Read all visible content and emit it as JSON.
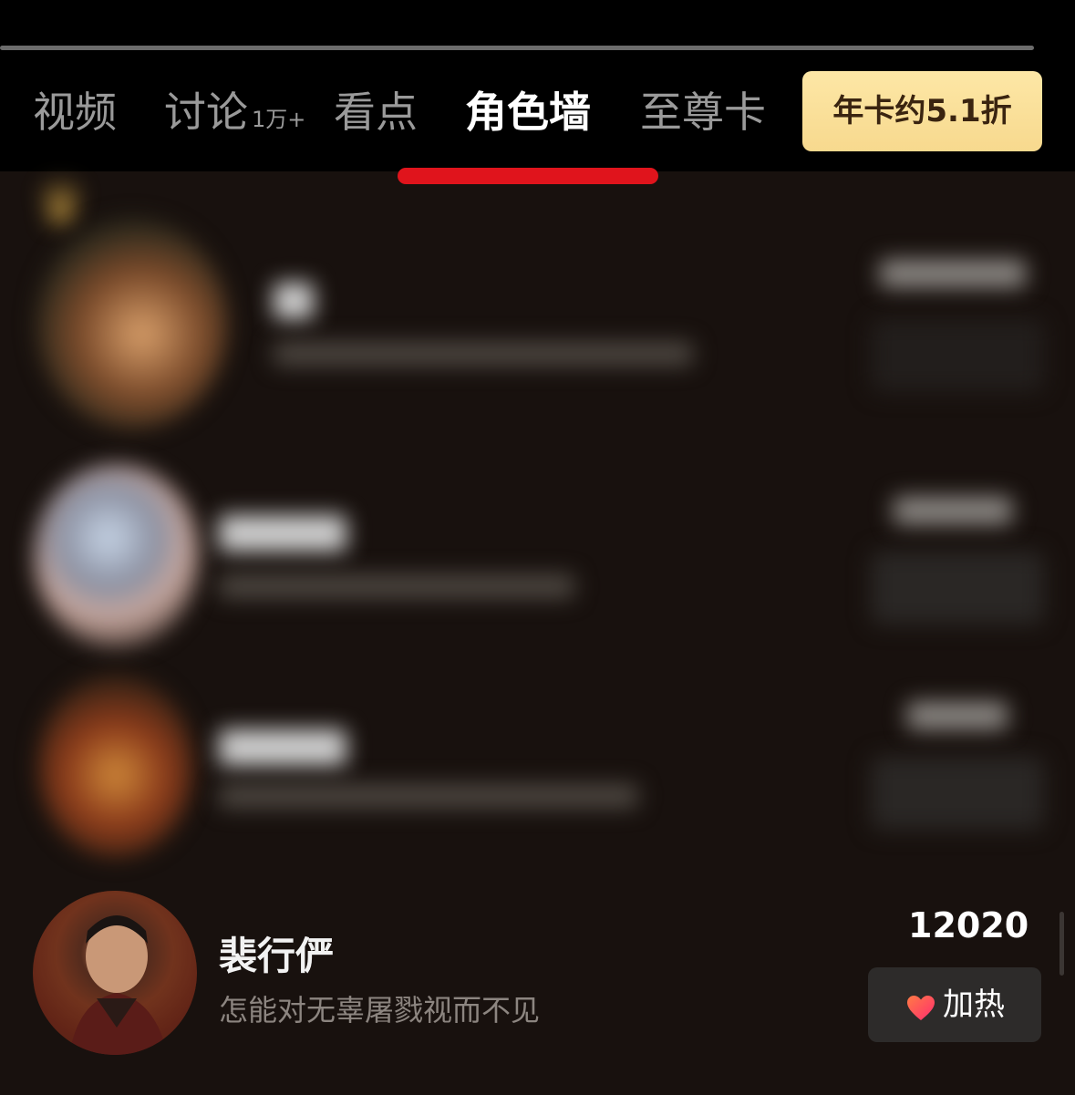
{
  "tabs": [
    {
      "label": "视频",
      "sup": ""
    },
    {
      "label": "讨论",
      "sup": "1万+"
    },
    {
      "label": "看点",
      "sup": ""
    },
    {
      "label": "角色墙",
      "sup": "",
      "active": true
    },
    {
      "label": "至尊卡",
      "sup": ""
    }
  ],
  "promo": {
    "label": "年卡约5.1折"
  },
  "rows": [
    {
      "name": "",
      "desc": "",
      "count": "",
      "button": ""
    },
    {
      "name": "",
      "desc": "",
      "count": "",
      "button": ""
    },
    {
      "name": "",
      "desc": "",
      "count": "",
      "button": ""
    },
    {
      "name": "裴行俨",
      "desc": "怎能对无辜屠戮视而不见",
      "count": "12020",
      "button": "加热"
    }
  ],
  "colors": {
    "background": "#18110e",
    "tab_indicator": "#e0141c",
    "promo_bg": "#fde7a6",
    "heat_button_bg": "#2d2b2a",
    "heart": "#ff3366"
  }
}
